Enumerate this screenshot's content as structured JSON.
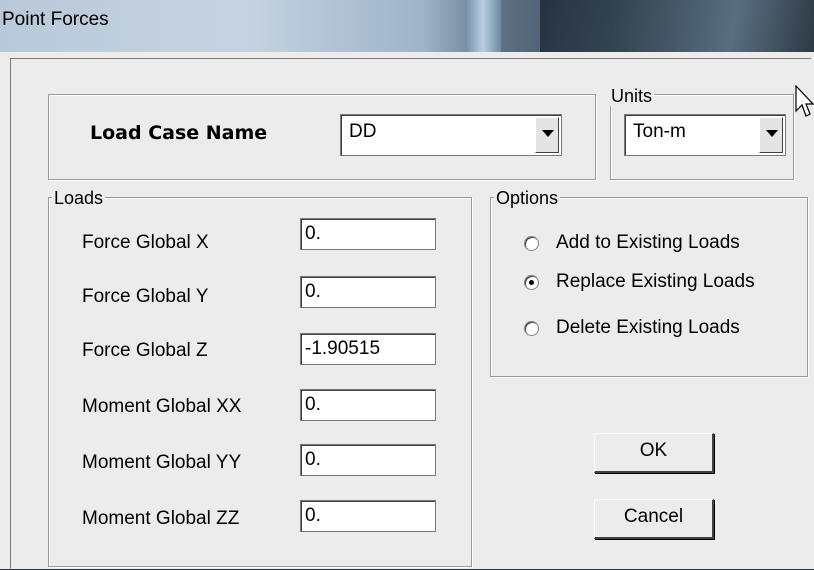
{
  "window": {
    "title": "Point Forces"
  },
  "load_case": {
    "label": "Load Case Name",
    "value": "DD"
  },
  "units": {
    "legend": "Units",
    "value": "Ton-m"
  },
  "loads": {
    "legend": "Loads",
    "fields": [
      {
        "label": "Force Global X",
        "value": "0."
      },
      {
        "label": "Force Global Y",
        "value": "0."
      },
      {
        "label": "Force Global Z",
        "value": "-1.90515"
      },
      {
        "label": "Moment Global XX",
        "value": "0."
      },
      {
        "label": "Moment Global YY",
        "value": "0."
      },
      {
        "label": "Moment Global ZZ",
        "value": "0."
      }
    ]
  },
  "options": {
    "legend": "Options",
    "items": [
      {
        "label": "Add to Existing Loads",
        "checked": false
      },
      {
        "label": "Replace Existing Loads",
        "checked": true
      },
      {
        "label": "Delete Existing Loads",
        "checked": false
      }
    ]
  },
  "buttons": {
    "ok": "OK",
    "cancel": "Cancel"
  },
  "icons": {
    "dropdown": "chevron-down-icon",
    "cursor": "mouse-pointer-icon"
  }
}
